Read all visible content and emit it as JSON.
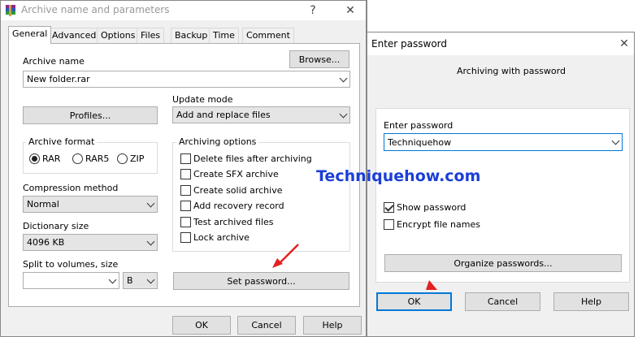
{
  "left_dialog": {
    "title": "Archive name and parameters",
    "help_glyph": "?",
    "close_glyph": "✕",
    "tabs": [
      {
        "label": "General",
        "active": true
      },
      {
        "label": "Advanced"
      },
      {
        "label": "Options"
      },
      {
        "label": "Files"
      },
      {
        "label": "Backup"
      },
      {
        "label": "Time"
      },
      {
        "label": "Comment"
      }
    ],
    "archive_name_label": "Archive name",
    "browse_label": "Browse...",
    "archive_name_value": "New folder.rar",
    "profiles_label": "Profiles...",
    "update_mode_label": "Update mode",
    "update_mode_value": "Add and replace files",
    "archive_format_label": "Archive format",
    "formats": [
      {
        "label": "RAR",
        "selected": true
      },
      {
        "label": "RAR5",
        "selected": false
      },
      {
        "label": "ZIP",
        "selected": false
      }
    ],
    "archiving_options_label": "Archiving options",
    "options": [
      {
        "label": "Delete files after archiving",
        "checked": false
      },
      {
        "label": "Create SFX archive",
        "checked": false
      },
      {
        "label": "Create solid archive",
        "checked": false
      },
      {
        "label": "Add recovery record",
        "checked": false
      },
      {
        "label": "Test archived files",
        "checked": false
      },
      {
        "label": "Lock archive",
        "checked": false
      }
    ],
    "compression_method_label": "Compression method",
    "compression_method_value": "Normal",
    "dictionary_size_label": "Dictionary size",
    "dictionary_size_value": "4096 KB",
    "split_label": "Split to volumes, size",
    "split_value": "",
    "split_unit_value": "B",
    "set_password_label": "Set password...",
    "ok_label": "OK",
    "cancel_label": "Cancel",
    "help_label": "Help"
  },
  "right_dialog": {
    "title": "Enter password",
    "close_glyph": "✕",
    "heading": "Archiving with password",
    "password_label": "Enter password",
    "password_value": "Techniquehow",
    "show_password_label": "Show password",
    "show_password_checked": true,
    "encrypt_names_label": "Encrypt file names",
    "encrypt_names_checked": false,
    "organize_label": "Organize passwords...",
    "ok_label": "OK",
    "cancel_label": "Cancel",
    "help_label": "Help"
  },
  "watermark": "Techniquehow.com",
  "colors": {
    "dialog_bg": "#f0f0f0",
    "button_bg": "#e1e1e1",
    "focus_blue": "#0078d7",
    "watermark_blue": "#1a3fd6",
    "arrow_red": "#e32121"
  }
}
